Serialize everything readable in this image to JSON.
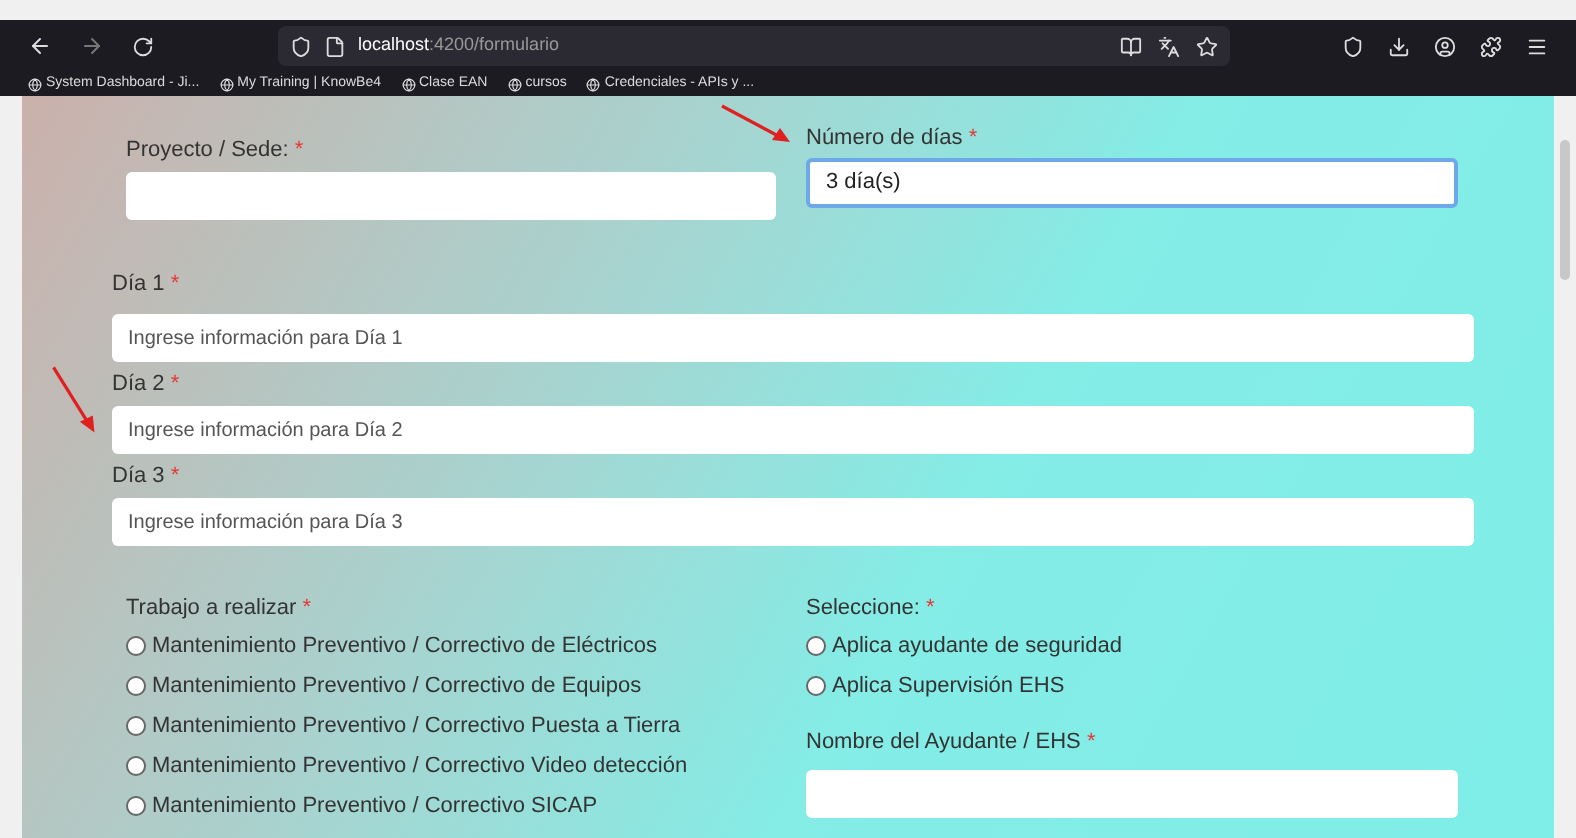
{
  "browser": {
    "url_host": "localhost",
    "url_path": ":4200/formulario",
    "bookmarks": [
      {
        "label": "System Dashboard - Ji..."
      },
      {
        "label": "My Training | KnowBe4"
      },
      {
        "label": "Clase EAN"
      },
      {
        "label": "cursos"
      },
      {
        "label": "Credenciales - APIs y ..."
      }
    ]
  },
  "form": {
    "proyecto": {
      "label": "Proyecto / Sede:",
      "required": "*"
    },
    "numero_dias": {
      "label": "Número de días",
      "required": "*",
      "value": "3 día(s)",
      "focused": true
    },
    "dias": [
      {
        "label": "Día 1",
        "required": "*",
        "placeholder": "Ingrese información para Día 1"
      },
      {
        "label": "Día 2",
        "required": "*",
        "placeholder": "Ingrese información para Día 2"
      },
      {
        "label": "Día 3",
        "required": "*",
        "placeholder": "Ingrese información para Día 3"
      }
    ],
    "trabajo": {
      "label": "Trabajo a realizar",
      "required": "*",
      "options": [
        {
          "label": "Mantenimiento Preventivo / Correctivo de Eléctricos",
          "selected": false
        },
        {
          "label": "Mantenimiento Preventivo / Correctivo de Equipos",
          "selected": false
        },
        {
          "label": "Mantenimiento Preventivo / Correctivo Puesta a Tierra",
          "selected": false
        },
        {
          "label": "Mantenimiento Preventivo / Correctivo Video detección",
          "selected": false
        },
        {
          "label": "Mantenimiento Preventivo / Correctivo SICAP",
          "selected": false
        }
      ]
    },
    "seleccione": {
      "label": "Seleccione:",
      "required": "*",
      "options": [
        {
          "label": "Aplica ayudante de seguridad",
          "selected": false
        },
        {
          "label": "Aplica Supervisión EHS",
          "selected": false
        }
      ]
    },
    "ayudante": {
      "label": "Nombre del Ayudante / EHS",
      "required": "*"
    }
  }
}
